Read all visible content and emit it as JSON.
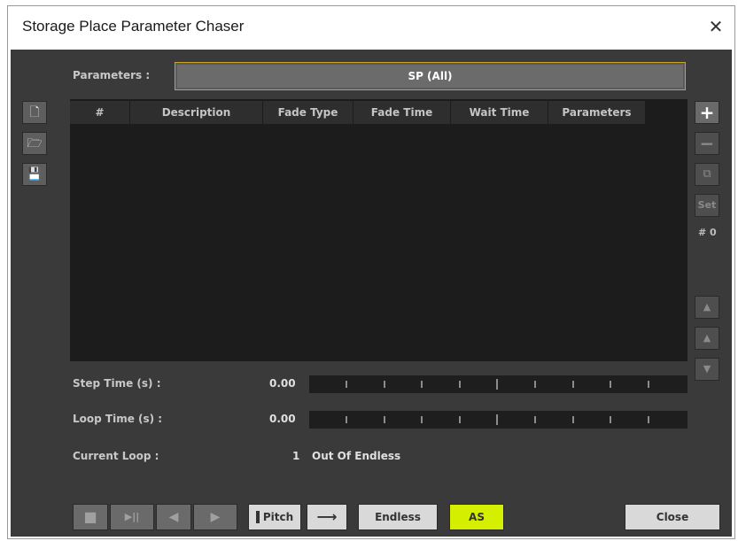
{
  "window": {
    "title": "Storage Place Parameter Chaser",
    "close_glyph": "✕"
  },
  "parameters": {
    "label": "Parameters :",
    "value": "SP (All)"
  },
  "table": {
    "columns": [
      "#",
      "Description",
      "Fade Type",
      "Fade Time",
      "Wait Time",
      "Parameters"
    ],
    "rows": []
  },
  "left_toolbar": [
    {
      "name": "new-file-icon",
      "glyph": "🗋"
    },
    {
      "name": "open-folder-icon",
      "glyph": "🗁"
    },
    {
      "name": "save-disk-icon",
      "glyph": "💾"
    }
  ],
  "right_toolbar": {
    "add": "+",
    "remove": "−",
    "copy": "⧉",
    "set": "Set",
    "step_index": "# 0",
    "move_top": "▲",
    "move_up": "▲",
    "move_down": "▼"
  },
  "step_time": {
    "label": "Step Time (s) :",
    "value": "0.00"
  },
  "loop_time": {
    "label": "Loop Time (s) :",
    "value": "0.00"
  },
  "current_loop": {
    "label": "Current Loop :",
    "count": "1",
    "text": "Out Of Endless"
  },
  "transport": {
    "stop": "■",
    "play_pause": "▶||",
    "prev": "◀",
    "next": "▶",
    "pitch": "Pitch",
    "direction": "⟶",
    "mode": "Endless",
    "as": "AS",
    "close": "Close"
  },
  "colors": {
    "background": "#3a3a3a",
    "accent_border": "#c9a227",
    "as_button": "#d4f000"
  }
}
